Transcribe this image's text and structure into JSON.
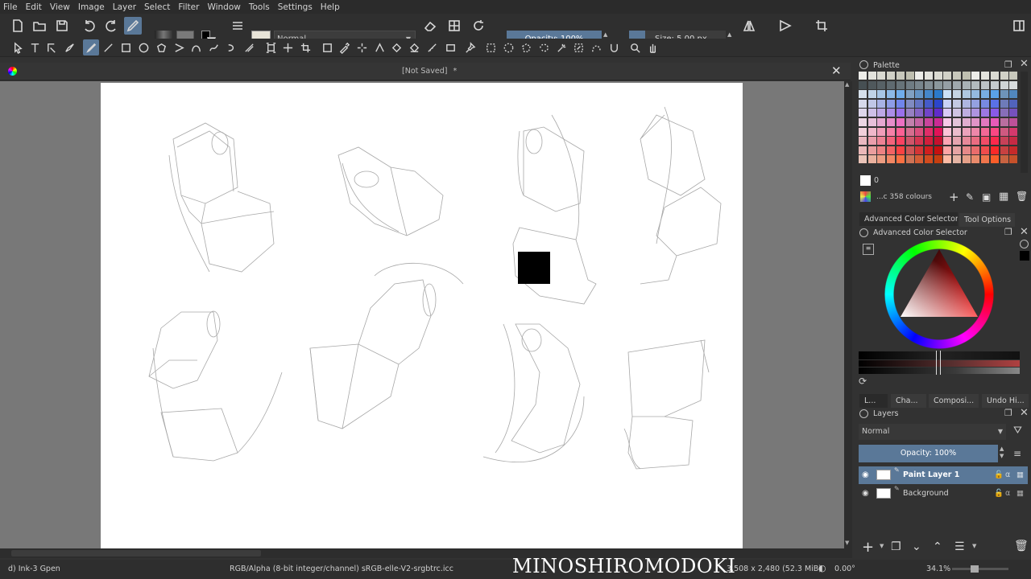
{
  "menu": [
    "File",
    "Edit",
    "View",
    "Image",
    "Layer",
    "Select",
    "Filter",
    "Window",
    "Tools",
    "Settings",
    "Help"
  ],
  "toolbar": {
    "blend_mode": "Normal",
    "opacity_label": "Opacity: 100%",
    "size_label": "Size: 5.00 px",
    "opacity_fraction": 1.0
  },
  "document": {
    "title": "[Not Saved]",
    "modified_marker": "*"
  },
  "palette": {
    "title": "Palette",
    "selected_index": "0",
    "colors_count": "...c 358 colours"
  },
  "docker_tabs_top": [
    "Advanced Color Selector",
    "Tool Options"
  ],
  "color_selector": {
    "title": "Advanced Color Selector"
  },
  "docker_tabs_bottom": [
    "L...",
    "Cha...",
    "Composi...",
    "Undo Hi..."
  ],
  "layers": {
    "title": "Layers",
    "blend_mode": "Normal",
    "opacity_label": "Opacity:  100%",
    "items": [
      {
        "name": "Paint Layer 1",
        "selected": true
      },
      {
        "name": "Background",
        "selected": false
      }
    ]
  },
  "status": {
    "brush": "d) Ink-3 Gpen",
    "color_space": "RGB/Alpha (8-bit integer/channel)  sRGB-elle-V2-srgbtrc.icc",
    "dimensions": "3,508 x 2,480 (52.3 MiB)",
    "rotation": "0.00°",
    "zoom": "34.1%"
  },
  "watermark": "MINOSHIROMODOKI",
  "colors": {
    "accent": "#5a7898",
    "fg_color": "#000000",
    "bg_color": "#ffffff"
  }
}
